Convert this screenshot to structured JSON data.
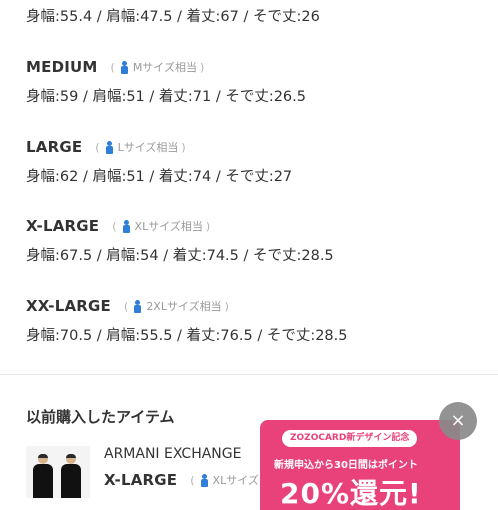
{
  "first_dims": "身幅:55.4 / 肩幅:47.5 / 着丈:67 / そで丈:26",
  "sizes": [
    {
      "name": "MEDIUM",
      "equiv": "Mサイズ相当",
      "dims": "身幅:59 / 肩幅:51 / 着丈:71 / そで丈:26.5"
    },
    {
      "name": "LARGE",
      "equiv": "Lサイズ相当",
      "dims": "身幅:62 / 肩幅:51 / 着丈:74 / そで丈:27"
    },
    {
      "name": "X-LARGE",
      "equiv": "XLサイズ相当",
      "dims": "身幅:67.5 / 肩幅:54 / 着丈:74.5 / そで丈:28.5"
    },
    {
      "name": "XX-LARGE",
      "equiv": "2XLサイズ相当",
      "dims": "身幅:70.5 / 肩幅:55.5 / 着丈:76.5 / そで丈:28.5"
    }
  ],
  "paren_open": "(",
  "paren_close": ")",
  "previous_section": {
    "title": "以前購入したアイテム",
    "brand": "ARMANI EXCHANGE",
    "size_name": "X-LARGE",
    "size_equiv": "XLサイズ"
  },
  "promo": {
    "tag": "ZOZOCARD新デザイン記念",
    "line": "新規申込から30日間はポイント",
    "big": "20%還元!"
  },
  "close_label": "×",
  "icons": {
    "person": "person-icon",
    "close": "close-icon"
  },
  "colors": {
    "accent_blue": "#2f7fd8",
    "promo_pink": "#e9427b"
  }
}
